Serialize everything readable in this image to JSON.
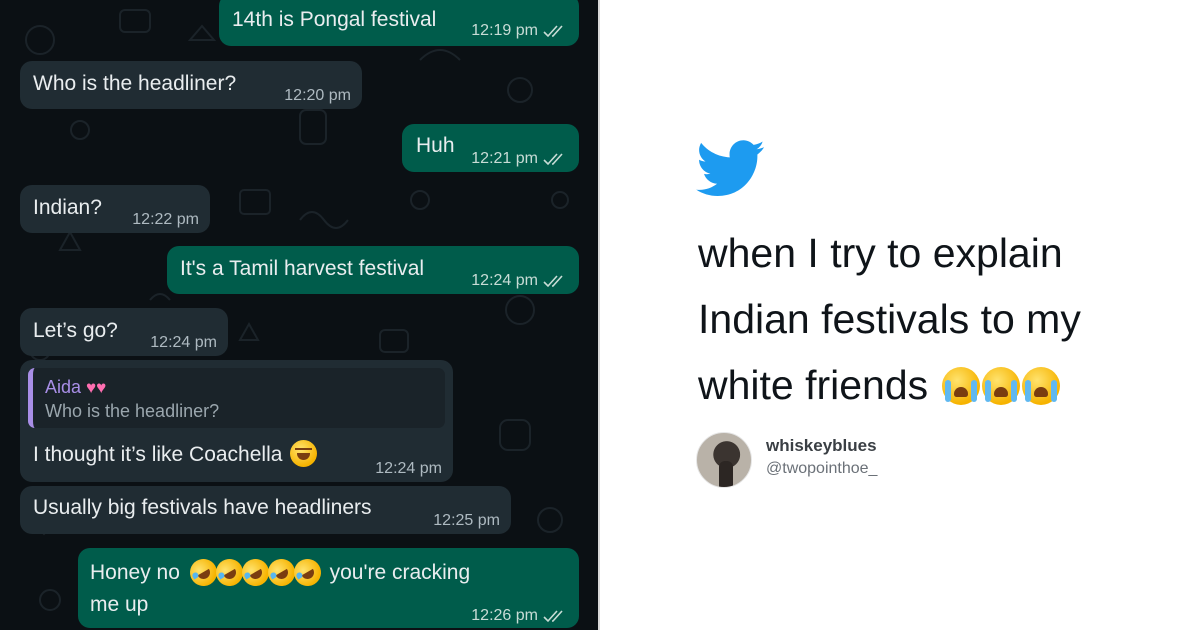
{
  "chat": {
    "messages": [
      {
        "id": "m1",
        "dir": "out",
        "text": "14th is Pongal festival",
        "time": "12:19 pm",
        "ticks": true
      },
      {
        "id": "m2",
        "dir": "in",
        "text": "Who is the headliner?",
        "time": "12:20 pm"
      },
      {
        "id": "m3",
        "dir": "out",
        "text": "Huh",
        "time": "12:21 pm",
        "ticks": true
      },
      {
        "id": "m4",
        "dir": "in",
        "text": "Indian?",
        "time": "12:22 pm"
      },
      {
        "id": "m5",
        "dir": "out",
        "text": "It's a Tamil harvest festival",
        "time": "12:24 pm",
        "ticks": true
      },
      {
        "id": "m6",
        "dir": "in",
        "text": "Let’s go?",
        "time": "12:24 pm"
      },
      {
        "id": "m7",
        "dir": "in",
        "quote_name": "Aida",
        "quote_text": "Who is the headliner?",
        "text": "I thought it’s like Coachella",
        "time": "12:24 pm"
      },
      {
        "id": "m8",
        "dir": "in",
        "text": "Usually big festivals have headliners",
        "time": "12:25 pm"
      },
      {
        "id": "m9",
        "dir": "out",
        "text_a": "Honey no",
        "text_b": "you're cracking",
        "text_c": "me up",
        "time": "12:26 pm",
        "ticks": true
      }
    ],
    "colors": {
      "background": "#0b1014",
      "incoming": "#202c33",
      "outgoing": "#005c4b",
      "quote_accent": "#a88ee6"
    }
  },
  "tweet": {
    "icon": "twitter-bird-icon",
    "lines": [
      "when I try to explain",
      "Indian festivals to my",
      "white friends"
    ],
    "display_name": "whiskeyblues",
    "handle": "@twopointhoe_",
    "colors": {
      "bird": "#1d9bf0",
      "text": "#0f1419"
    }
  }
}
